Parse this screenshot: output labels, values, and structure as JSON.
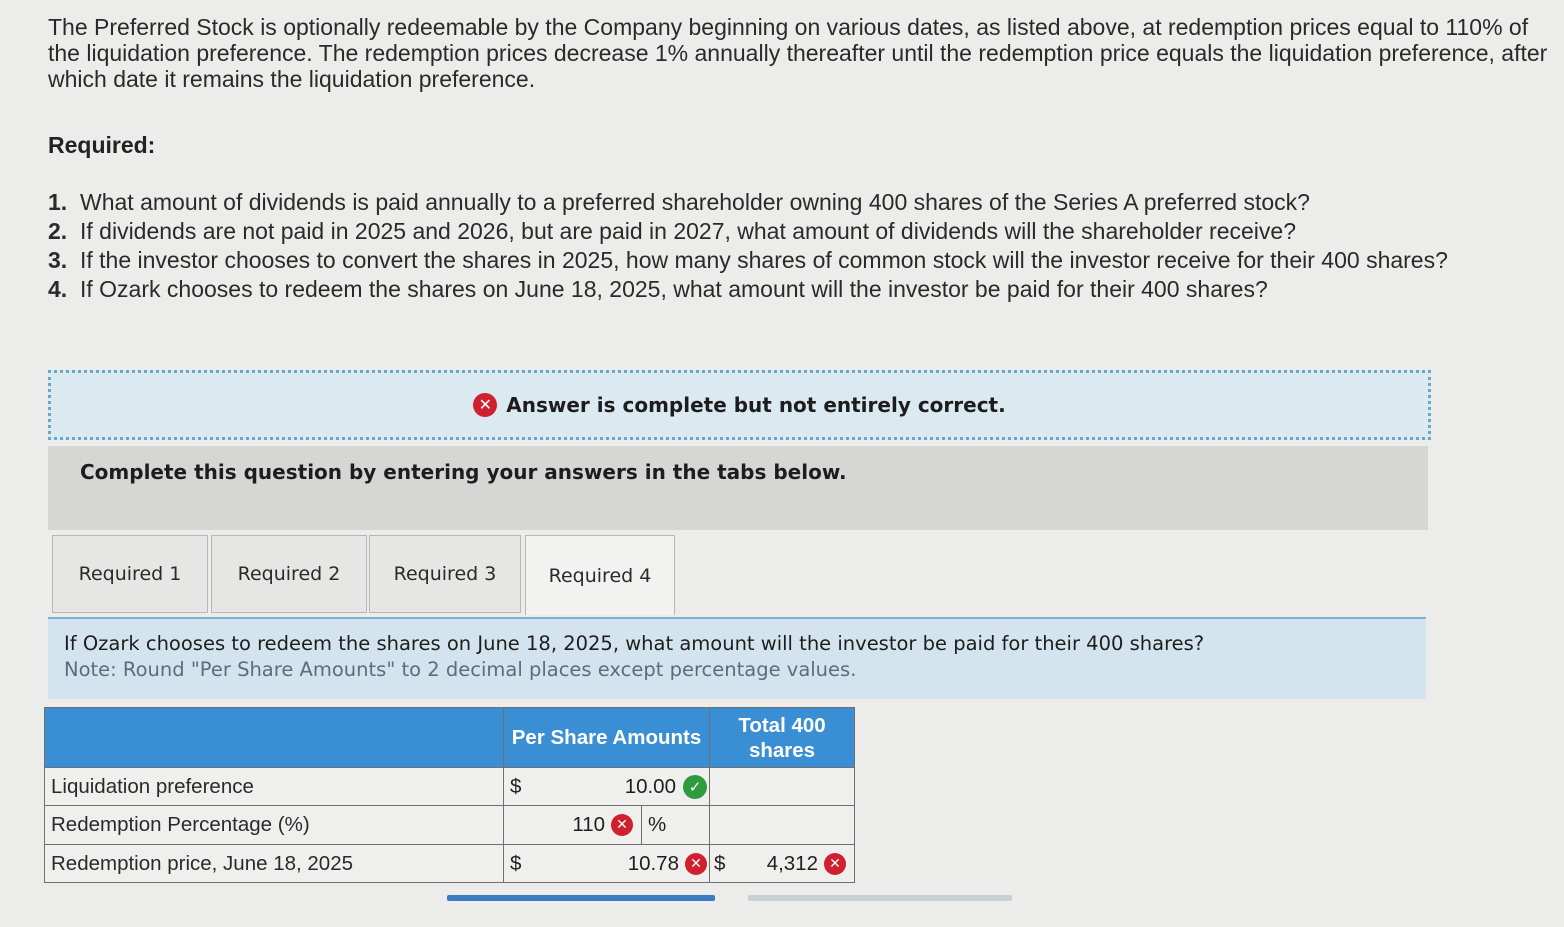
{
  "intro_text": "The Preferred Stock is optionally redeemable by the Company beginning on various dates, as listed above, at redemption prices equal to 110% of the liquidation preference. The redemption prices decrease 1% annually thereafter until the redemption price equals the liquidation preference, after which date it remains the liquidation preference.",
  "required_heading": "Required:",
  "questions": [
    {
      "num": "1.",
      "text": "What amount of dividends is paid annually to a preferred shareholder owning 400 shares of the Series A preferred stock?"
    },
    {
      "num": "2.",
      "text": "If dividends are not paid in 2025 and 2026, but are paid in 2027, what amount of dividends will the shareholder receive?"
    },
    {
      "num": "3.",
      "text": "If the investor chooses to convert the shares in 2025, how many shares of common stock will the investor receive for their 400 shares?"
    },
    {
      "num": "4.",
      "text": "If Ozark chooses to redeem the shares on June 18, 2025, what amount will the investor be paid for their 400 shares?"
    }
  ],
  "status": {
    "text": "Answer is complete but not entirely correct.",
    "icon": "x-circle-icon",
    "color": "#d0202f"
  },
  "instruction": "Complete this question by entering your answers in the tabs below.",
  "tabs": [
    "Required 1",
    "Required 2",
    "Required 3",
    "Required 4"
  ],
  "active_tab": "Required 4",
  "panel": {
    "question": "If Ozark chooses to redeem the shares on June 18, 2025, what amount will the investor be paid for their 400 shares?",
    "note": "Note: Round \"Per Share Amounts\" to 2 decimal places except percentage values."
  },
  "table": {
    "headers": [
      "Per Share Amounts",
      "Total 400 shares"
    ],
    "rows": [
      {
        "label": "Liquidation preference",
        "per_share_prefix": "$",
        "per_share": "10.00",
        "per_share_status": "correct",
        "total_prefix": "",
        "total": "",
        "total_status": ""
      },
      {
        "label": "Redemption Percentage (%)",
        "per_share": "110",
        "per_share_status": "incorrect",
        "suffix": "%"
      },
      {
        "label": "Redemption price, June 18, 2025",
        "per_share_prefix": "$",
        "per_share": "10.78",
        "per_share_status": "incorrect",
        "total_prefix": "$",
        "total": "4,312",
        "total_status": "incorrect"
      }
    ]
  },
  "colors": {
    "header_blue": "#3a8ed4",
    "correct_green": "#2e9b3f",
    "incorrect_red": "#d0202f"
  }
}
